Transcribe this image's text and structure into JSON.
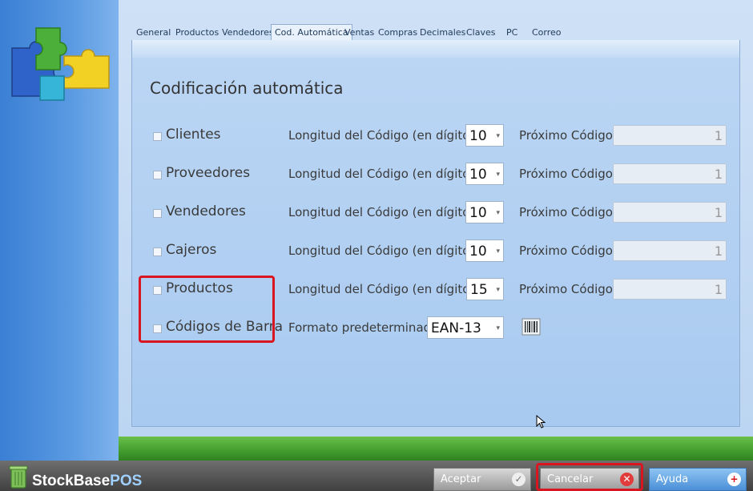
{
  "tabs": [
    {
      "label": "General"
    },
    {
      "label": "Productos"
    },
    {
      "label": "Vendedores"
    },
    {
      "label": "Cod. Automática",
      "active": true
    },
    {
      "label": "Ventas"
    },
    {
      "label": "Compras"
    },
    {
      "label": "Decimales"
    },
    {
      "label": "Claves"
    },
    {
      "label": "PC"
    },
    {
      "label": "Correo"
    }
  ],
  "section_title": "Codificación automática",
  "length_label": "Longitud del Código (en dígitos)",
  "next_label": "Próximo Código",
  "rows": [
    {
      "label": "Clientes",
      "length": "10",
      "next": "1"
    },
    {
      "label": "Proveedores",
      "length": "10",
      "next": "1"
    },
    {
      "label": "Vendedores",
      "length": "10",
      "next": "1"
    },
    {
      "label": "Cajeros",
      "length": "10",
      "next": "1"
    },
    {
      "label": "Productos",
      "length": "15",
      "next": "1"
    }
  ],
  "barcode_row": {
    "label": "Códigos de Barra",
    "format_label": "Formato predeterminado",
    "format_value": "EAN-13"
  },
  "brand": {
    "main": "StockBase",
    "suffix": "POS"
  },
  "buttons": {
    "accept": "Aceptar",
    "cancel": "Cancelar",
    "help": "Ayuda"
  },
  "colors": {
    "highlight": "#d9161f",
    "accent_blue": "#4b8fd8"
  }
}
